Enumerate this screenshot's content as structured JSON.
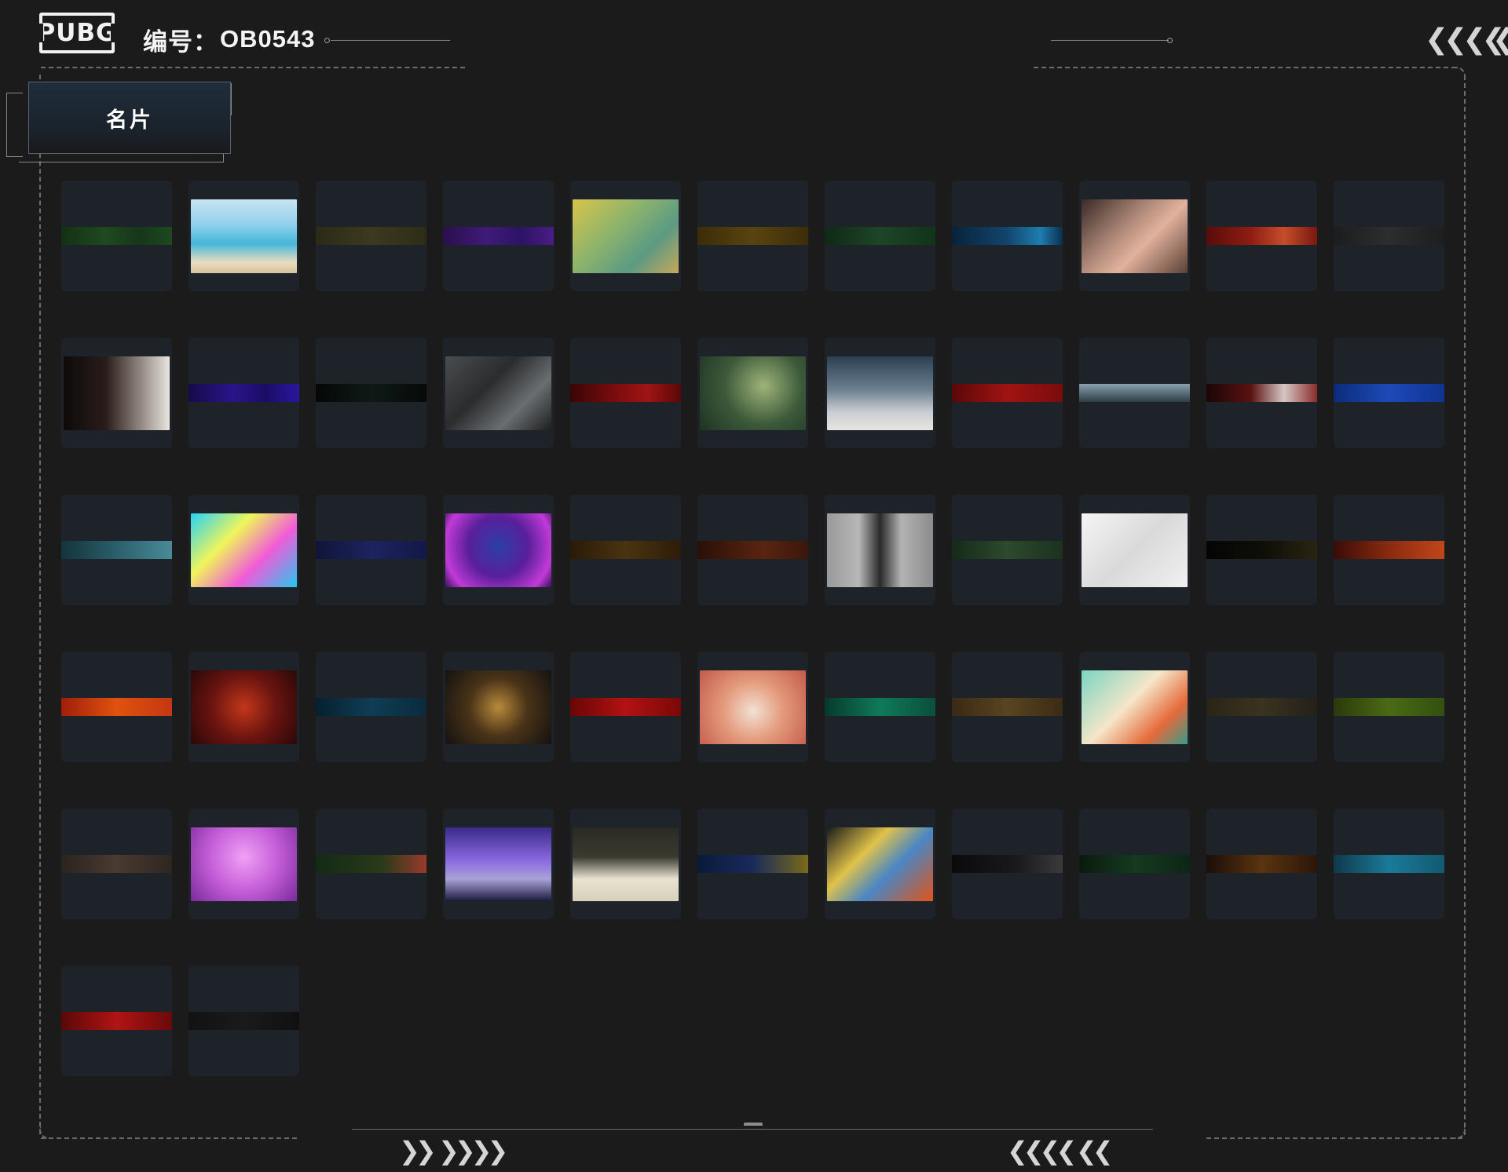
{
  "header": {
    "logo_text": "PUBG",
    "id_label": "编号：",
    "id_value": "OB0543"
  },
  "tab": {
    "label": "名片"
  },
  "colors": {
    "background": "#1b1b1c",
    "cell": "#1e232a",
    "frame": "#6b6d70"
  },
  "cards": [
    {
      "kind": "strip",
      "style": "linear-gradient(90deg,#143015,#1f4a1e 40%,#16361a 70%,#1c4a1f)"
    },
    {
      "kind": "image",
      "style": "linear-gradient(180deg,#c9e4f1 0%,#8ed0ea 35%,#45b6d8 60%,#e9ddc0 85%,#d6c29a 100%)",
      "icon": "seagull-icon"
    },
    {
      "kind": "strip",
      "style": "linear-gradient(90deg,#2b2a17,#3b3a1f 50%,#2d2c18)"
    },
    {
      "kind": "strip",
      "style": "linear-gradient(90deg,#2a0f4e,#3f1a7a 40%,#2c1364 70%,#4a1d86)"
    },
    {
      "kind": "image",
      "style": "linear-gradient(135deg,#d7c44a 0%,#8db36c 40%,#5b9a83 70%,#c6a85a 100%)",
      "icon": "frog-icon"
    },
    {
      "kind": "strip",
      "style": "linear-gradient(90deg,#3b2c08,#5a4310 50%,#3d2d09)"
    },
    {
      "kind": "strip",
      "style": "linear-gradient(90deg,#0f2a16,#1d4526 50%,#113319)"
    },
    {
      "kind": "strip",
      "style": "linear-gradient(90deg,#08233a,#12456d 50%,#1d7db0 80%,#0b2f4d)"
    },
    {
      "kind": "image",
      "style": "linear-gradient(135deg,#3a2a26 0%,#b08a7a 40%,#e1b29c 60%,#5a3f36 100%)",
      "icon": "portrait-icon"
    },
    {
      "kind": "strip",
      "style": "linear-gradient(90deg,#5a0c0a,#8f1c12 40%,#c44d2a 70%,#7a1710)"
    },
    {
      "kind": "strip",
      "style": "linear-gradient(90deg,#1b1d1e,#2b2d2e 50%,#1c1e1f)"
    },
    {
      "kind": "image",
      "style": "linear-gradient(90deg,#0d0a0a 0%,#2a1c1a 40%,#8a7f7a 70%,#e9e5df 100%)",
      "icon": "gun-icon"
    },
    {
      "kind": "strip",
      "style": "linear-gradient(90deg,#160a4a,#2a1589 40%,#1b0c66 70%,#2a17a0)"
    },
    {
      "kind": "strip",
      "style": "linear-gradient(90deg,#050707,#0e1a16 50%,#070909)"
    },
    {
      "kind": "image",
      "style": "linear-gradient(135deg,#4a4d4f 0%,#2a2c2e 40%,#6b6e70 70%,#1c1e20 100%)",
      "icon": "logo-icon"
    },
    {
      "kind": "strip",
      "style": "linear-gradient(90deg,#3a0506,#7a0c0c 40%,#a01414 70%,#5a0808)"
    },
    {
      "kind": "image",
      "style": "radial-gradient(circle at 60% 40%,#9fb37a 0%,#3c5a3a 50%,#1f3324 100%)",
      "icon": "champagne-icon"
    },
    {
      "kind": "image",
      "style": "linear-gradient(180deg,#2c3f52 0%,#6c7f8f 45%,#c9cdd2 75%,#e7e4df 100%)",
      "icon": "snowman-icon"
    },
    {
      "kind": "strip",
      "style": "linear-gradient(90deg,#5a0707,#a11313 50%,#7a0c0c)"
    },
    {
      "kind": "strip",
      "style": "linear-gradient(180deg,#8aa0b0,#5a6f7a 50%,#2f3e45)"
    },
    {
      "kind": "strip",
      "style": "linear-gradient(90deg,#1a0606,#5a1111 40%,#d6c7c4 70%,#8a2b2b)"
    },
    {
      "kind": "strip",
      "style": "linear-gradient(90deg,#0c2c7a,#1d4ab8 50%,#0f3390)"
    },
    {
      "kind": "strip",
      "style": "linear-gradient(90deg,#14343c,#2a5f6b 50%,#4a8b99)"
    },
    {
      "kind": "image",
      "style": "linear-gradient(135deg,#26d3f5 0%,#f0f55a 35%,#f15bd8 65%,#26c7f0 100%)",
      "icon": "newjeans-logo-icon"
    },
    {
      "kind": "strip",
      "style": "linear-gradient(90deg,#10143a,#1d235e 50%,#131848)"
    },
    {
      "kind": "image",
      "style": "radial-gradient(circle at 50% 45%,#2b3fa8 0%,#5a1f9a 45%,#c13ad8 80%,#3a0f5a 100%)",
      "icon": "hooded-figure-icon"
    },
    {
      "kind": "strip",
      "style": "linear-gradient(90deg,#2a1a07,#4a3310 50%,#2d1c08)"
    },
    {
      "kind": "strip",
      "style": "linear-gradient(90deg,#2a1008,#5a2410 60%,#3a170b)"
    },
    {
      "kind": "image",
      "style": "linear-gradient(90deg,#9a9a9a 0%,#b7b7b7 30%,#2a2a2a 50%,#b3b3b3 70%,#8c8c8c 100%)",
      "icon": "shadow-figure-icon"
    },
    {
      "kind": "strip",
      "style": "linear-gradient(90deg,#152a1a,#2c4a2c 50%,#1b321f)"
    },
    {
      "kind": "image",
      "style": "linear-gradient(135deg,#f4f4f4 0%,#dadada 50%,#f0f0f0 100%)",
      "icon": "sketch-figure-icon"
    },
    {
      "kind": "strip",
      "style": "linear-gradient(90deg,#050505,#0e0e08 50%,#2a2410)"
    },
    {
      "kind": "strip",
      "style": "linear-gradient(90deg,#3a0c06,#8a2a10 50%,#c2461a)"
    },
    {
      "kind": "strip",
      "style": "linear-gradient(90deg,#a01e0a,#e0520f 50%,#c23810)"
    },
    {
      "kind": "image",
      "style": "radial-gradient(circle at 50% 50%,#c2371a 0%,#6a1410 50%,#2a0808 100%)",
      "icon": "bull-icon"
    },
    {
      "kind": "strip",
      "style": "linear-gradient(90deg,#06202e,#0f3d55 50%,#0a2b3c)"
    },
    {
      "kind": "image",
      "style": "radial-gradient(circle at 50% 50%,#b88a3a 0%,#4a3318 45%,#141210 100%)",
      "icon": "swirl-icon"
    },
    {
      "kind": "strip",
      "style": "linear-gradient(90deg,#6a0606,#b21212 50%,#7a0808)"
    },
    {
      "kind": "image",
      "style": "radial-gradient(circle at 50% 55%,#f2e1d3 0%,#e49a7c 45%,#c25a4a 100%)",
      "icon": "dragon-icon"
    },
    {
      "kind": "strip",
      "style": "linear-gradient(90deg,#063a2a,#0f7a5a 50%,#0a4e3c)"
    },
    {
      "kind": "strip",
      "style": "linear-gradient(90deg,#3a2a14,#5a4420 50%,#3b2b15)"
    },
    {
      "kind": "image",
      "style": "linear-gradient(135deg,#7ad5c2 0%,#f5e6c8 45%,#e56a3a 75%,#3a9a8a 100%)",
      "icon": "twin-dragon-icon"
    },
    {
      "kind": "strip",
      "style": "linear-gradient(90deg,#2a2416,#3a331f 50%,#24201a)"
    },
    {
      "kind": "strip",
      "style": "linear-gradient(90deg,#2a3a0a,#4a6a14 50%,#335010)"
    },
    {
      "kind": "strip",
      "style": "linear-gradient(90deg,#2a2420,#4a3a30 50%,#2e2620)"
    },
    {
      "kind": "image",
      "style": "radial-gradient(circle at 50% 40%,#f0a0f5 0%,#c45ed8 50%,#7a2a9a 100%)",
      "icon": "girl-icon"
    },
    {
      "kind": "strip",
      "style": "linear-gradient(90deg,#122a14,#2a3a1a 60%,#9a3a2a)"
    },
    {
      "kind": "image",
      "style": "linear-gradient(180deg,#3a2a8a 0%,#8a6ae0 45%,#a9a2d8 70%,#1a1a3a 100%)",
      "icon": "disco-icon"
    },
    {
      "kind": "image",
      "style": "linear-gradient(180deg,#2a2a24 0%,#3a3a30 40%,#e8e2d0 70%,#d8d0bb 100%)",
      "icon": "playing-cards-icon"
    },
    {
      "kind": "strip",
      "style": "linear-gradient(90deg,#0a1a3a,#1a2a5a 50%,#7a6a1a)"
    },
    {
      "kind": "image",
      "style": "linear-gradient(135deg,#1a1a1a 0%,#e0c24a 35%,#4a86c4 60%,#e0541a 100%)",
      "icon": "helmet-icon"
    },
    {
      "kind": "strip",
      "style": "linear-gradient(90deg,#0a0a0a,#1a1a1a 60%,#3a3a3a)"
    },
    {
      "kind": "strip",
      "style": "linear-gradient(90deg,#0a1a0e,#143a1f 50%,#0c2614)"
    },
    {
      "kind": "strip",
      "style": "linear-gradient(90deg,#1a0e06,#5a3410 50%,#2a1608)"
    },
    {
      "kind": "strip",
      "style": "linear-gradient(90deg,#0e3a4a,#1a7a9a 50%,#125a70)"
    },
    {
      "kind": "strip",
      "style": "linear-gradient(90deg,#5a0808,#b01414 50%,#6a0a0a)"
    },
    {
      "kind": "strip",
      "style": "linear-gradient(90deg,#121212,#1a1a1a 50%,#101010)"
    }
  ]
}
